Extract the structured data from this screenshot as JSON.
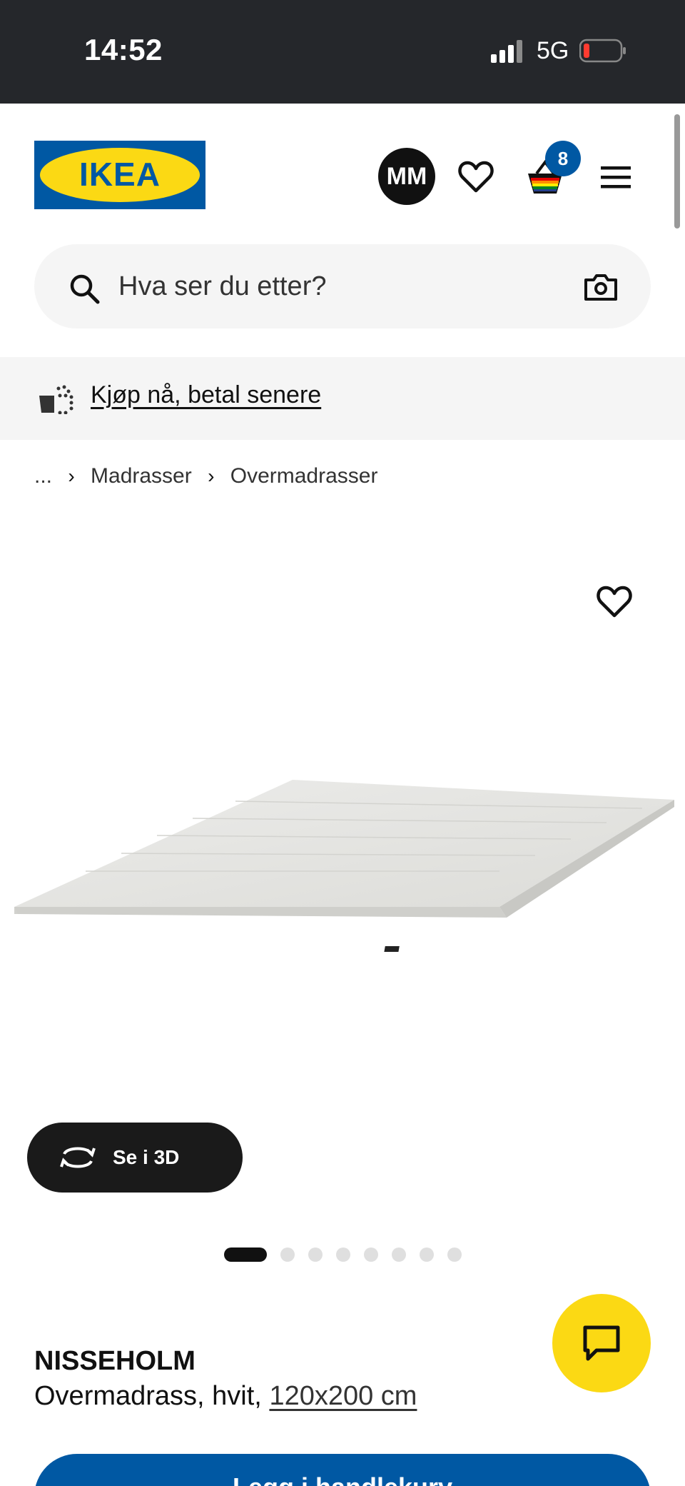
{
  "status_bar": {
    "time": "14:52",
    "network": "5G"
  },
  "header": {
    "logo_text": "IKEA",
    "avatar_initials": "MM",
    "cart_count": "8"
  },
  "search": {
    "placeholder": "Hva ser du etter?"
  },
  "banner": {
    "link": "Kjøp nå, betal senere"
  },
  "breadcrumb": {
    "ellipsis": "...",
    "items": [
      "Madrasser",
      "Overmadrasser"
    ]
  },
  "gallery": {
    "view_3d_label": "Se i 3D",
    "image_count": 8,
    "active_index": 0
  },
  "product": {
    "name": "NISSEHOLM",
    "description": "Overmadrass, hvit,",
    "size": "120x200 cm"
  },
  "cta": {
    "label": "Legg i handlekurv"
  },
  "colors": {
    "ikea_blue": "#0058a3",
    "ikea_yellow": "#fbd914",
    "statusbar": "#25272b"
  }
}
